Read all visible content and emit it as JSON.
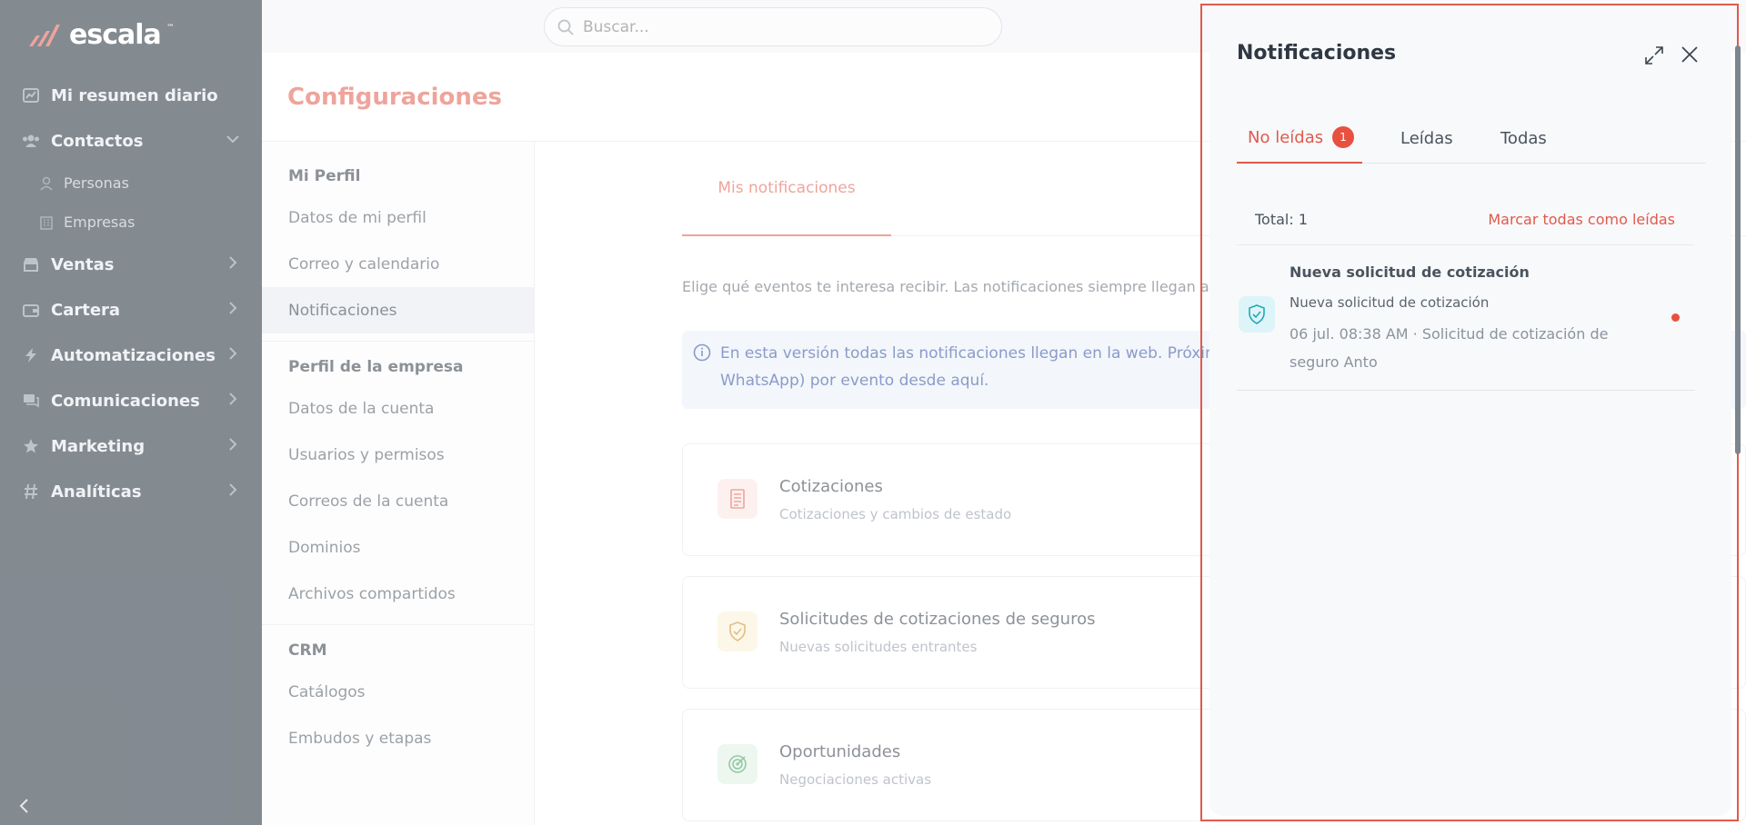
{
  "app": {
    "logo_text": "escala",
    "logo_tm": "™"
  },
  "search": {
    "placeholder": "Buscar..."
  },
  "sidebar": {
    "items": [
      {
        "label": "Mi resumen diario",
        "icon": "chart-icon"
      },
      {
        "label": "Contactos",
        "icon": "users-icon",
        "expanded": true
      },
      {
        "label": "Personas",
        "icon": "person-icon",
        "sub": true
      },
      {
        "label": "Empresas",
        "icon": "building-icon",
        "sub": true
      },
      {
        "label": "Ventas",
        "icon": "shop-icon"
      },
      {
        "label": "Cartera",
        "icon": "wallet-icon"
      },
      {
        "label": "Automatizaciones",
        "icon": "bolt-icon"
      },
      {
        "label": "Comunicaciones",
        "icon": "chat-icon"
      },
      {
        "label": "Marketing",
        "icon": "star-icon"
      },
      {
        "label": "Analíticas",
        "icon": "hash-icon"
      }
    ]
  },
  "page": {
    "title": "Configuraciones"
  },
  "settings_menu": {
    "sections": [
      {
        "title": "Mi Perfil",
        "items": [
          "Datos de mi perfil",
          "Correo y calendario",
          "Notificaciones"
        ]
      },
      {
        "title": "Perfil de la empresa",
        "items": [
          "Datos de la cuenta",
          "Usuarios y permisos",
          "Correos de la cuenta",
          "Dominios",
          "Archivos compartidos"
        ]
      },
      {
        "title": "CRM",
        "items": [
          "Catálogos",
          "Embudos y etapas"
        ]
      }
    ],
    "active": "Notificaciones"
  },
  "main": {
    "tab": "Mis notificaciones",
    "description": "Elige qué eventos te interesa recibir. Las notificaciones siempre llegan al p",
    "info_line1": "En esta versión todas las notificaciones llegan en la web. Próximam",
    "info_line2": "WhatsApp) por evento desde aquí.",
    "cards": [
      {
        "title": "Cotizaciones",
        "subtitle": "Cotizaciones y cambios de estado",
        "icon": "document-icon",
        "color": "#e05a4c"
      },
      {
        "title": "Solicitudes de cotizaciones de seguros",
        "subtitle": "Nuevas solicitudes entrantes",
        "icon": "shield-icon",
        "color": "#e0a030"
      },
      {
        "title": "Oportunidades",
        "subtitle": "Negociaciones activas",
        "icon": "target-icon",
        "color": "#3f9c5a"
      }
    ]
  },
  "notifications_panel": {
    "title": "Notificaciones",
    "tabs": [
      {
        "label": "No leídas",
        "badge": "1",
        "active": true
      },
      {
        "label": "Leídas"
      },
      {
        "label": "Todas"
      }
    ],
    "total": "Total: 1",
    "mark_all": "Marcar todas como leídas",
    "items": [
      {
        "title": "Nueva solicitud de cotización",
        "subtitle": "Nueva solicitud de cotización",
        "meta": "06 jul. 08:38 AM  · Solicitud de cotización de seguro Anto",
        "icon": "shield-check-icon",
        "unread": true
      }
    ]
  },
  "colors": {
    "accent": "#e05a4c",
    "sidebar_bg": "#1e2a36",
    "info_bg": "#e9eef8"
  }
}
